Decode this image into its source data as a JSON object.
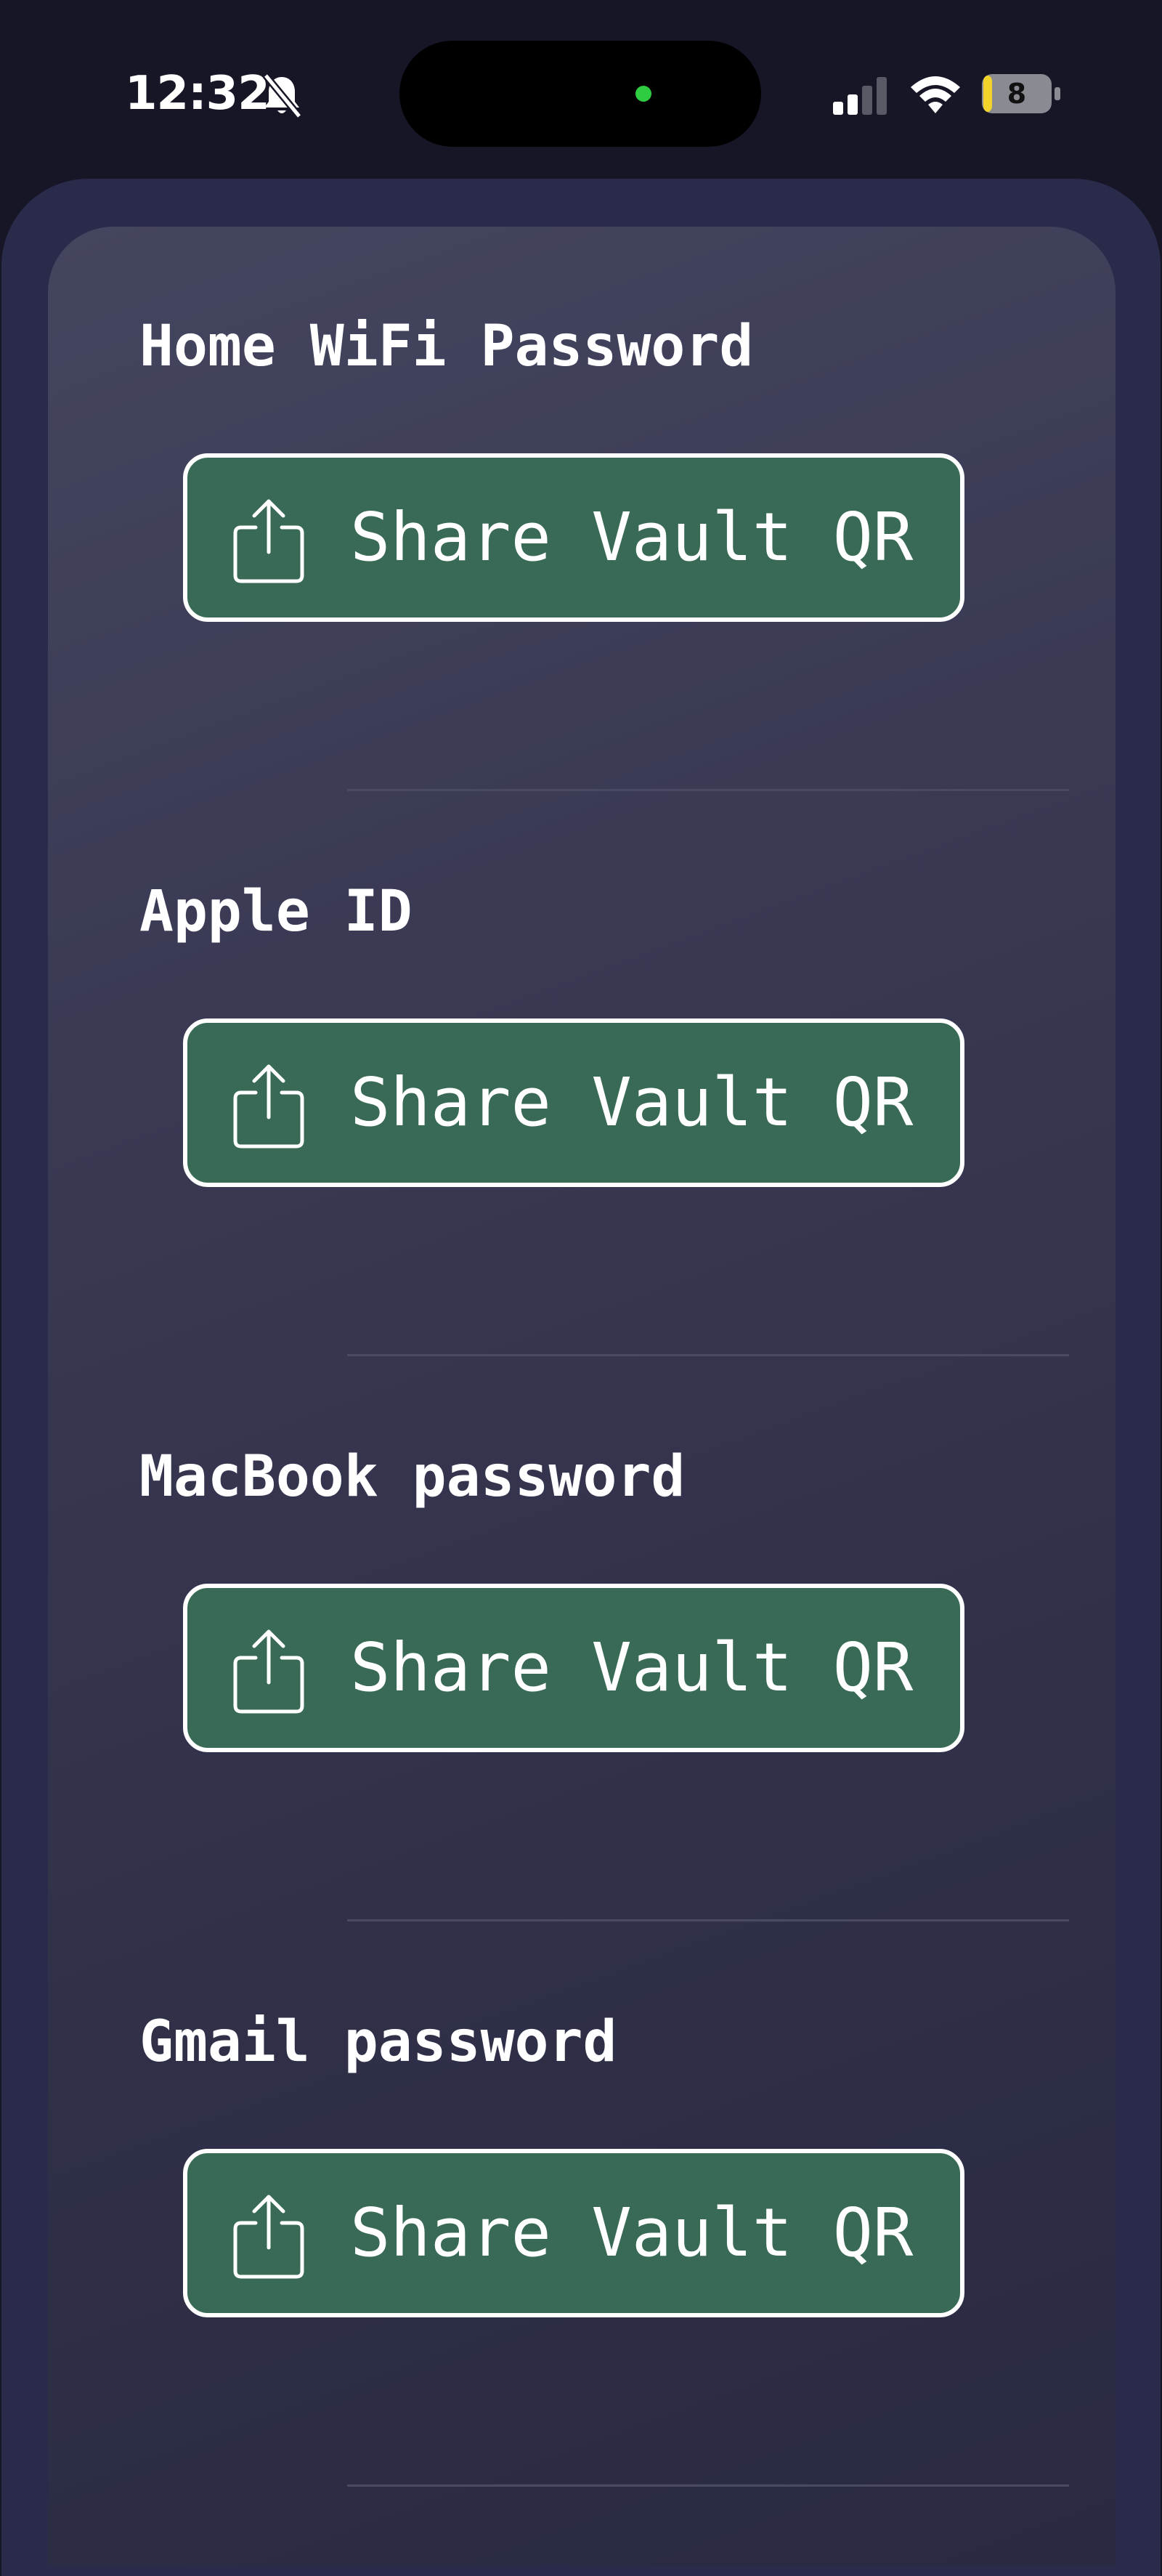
{
  "status_bar": {
    "time": "12:32",
    "battery_level": "8",
    "icons": [
      "bell-slash-icon",
      "cellular-signal-icon",
      "wifi-icon",
      "battery-icon"
    ]
  },
  "colors": {
    "background": "#161627",
    "card": "#3a3a55",
    "button": "#386a55",
    "button_border": "#ffffff",
    "text": "#ffffff"
  },
  "entries": [
    {
      "title": "Home WiFi Password",
      "button_label": "Share Vault QR",
      "icon": "share-icon"
    },
    {
      "title": "Apple ID",
      "button_label": "Share Vault QR",
      "icon": "share-icon"
    },
    {
      "title": "MacBook password",
      "button_label": "Share Vault QR",
      "icon": "share-icon"
    },
    {
      "title": "Gmail password",
      "button_label": "Share Vault QR",
      "icon": "share-icon"
    }
  ]
}
